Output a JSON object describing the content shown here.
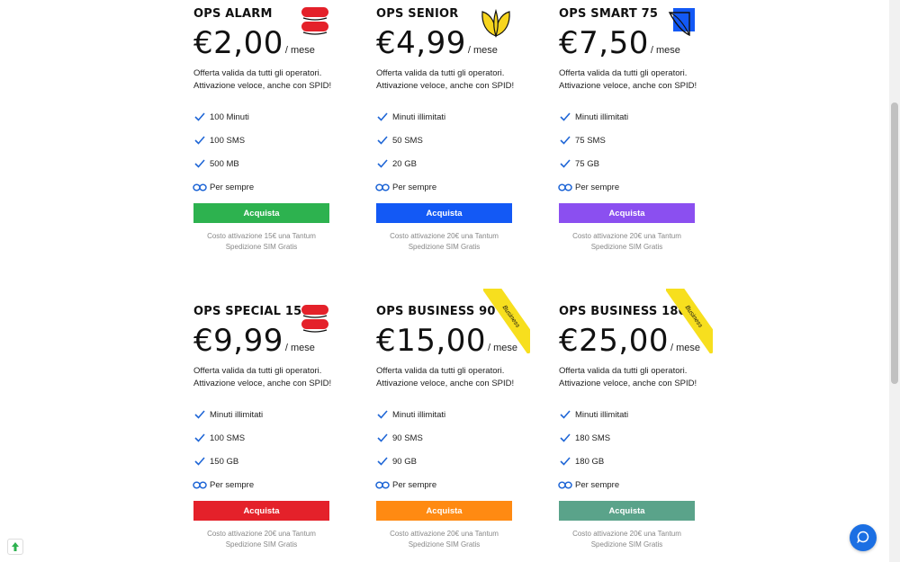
{
  "plans": [
    {
      "title": "OPS ALARM",
      "price": "€2,00",
      "per": "/ mese",
      "desc1": "Offerta valida da tutti gli operatori.",
      "desc2": "Attivazione veloce, anche con SPID!",
      "features": [
        "100 Minuti",
        "100 SMS",
        "500 MB",
        "Per sempre"
      ],
      "button": "Acquista",
      "button_color": "#2db24f",
      "note1": "Costo attivazione 15€ una Tantum",
      "note2": "Spedizione SIM Gratis",
      "logo": "red-stacked-pill-logo"
    },
    {
      "title": "OPS SENIOR",
      "price": "€4,99",
      "per": "/ mese",
      "desc1": "Offerta valida da tutti gli operatori.",
      "desc2": "Attivazione veloce, anche con SPID!",
      "features": [
        "Minuti illimitati",
        "50 SMS",
        "20 GB",
        "Per sempre"
      ],
      "button": "Acquista",
      "button_color": "#1359f5",
      "note1": "Costo attivazione 20€ una Tantum",
      "note2": "Spedizione SIM Gratis",
      "logo": "yellow-leaf-logo"
    },
    {
      "title": "OPS SMART 75",
      "price": "€7,50",
      "per": "/ mese",
      "desc1": "Offerta valida da tutti gli operatori.",
      "desc2": "Attivazione veloce, anche con SPID!",
      "features": [
        "Minuti illimitati",
        "75 SMS",
        "75 GB",
        "Per sempre"
      ],
      "button": "Acquista",
      "button_color": "#8b4ff0",
      "note1": "Costo attivazione 20€ una Tantum",
      "note2": "Spedizione SIM Gratis",
      "logo": "blue-page-logo"
    },
    {
      "title": "OPS SPECIAL 150",
      "price": "€9,99",
      "per": "/ mese",
      "desc1": "Offerta valida da tutti gli operatori.",
      "desc2": "Attivazione veloce, anche con SPID!",
      "features": [
        "Minuti illimitati",
        "100 SMS",
        "150 GB",
        "Per sempre"
      ],
      "button": "Acquista",
      "button_color": "#e4212a",
      "note1": "Costo attivazione 20€ una Tantum",
      "note2": "Spedizione SIM Gratis",
      "logo": "red-stacked-pill-logo"
    },
    {
      "title": "OPS BUSINESS 90",
      "price": "€15,00",
      "per": "/ mese",
      "desc1": "Offerta valida da tutti gli operatori.",
      "desc2": "Attivazione veloce, anche con SPID!",
      "features": [
        "Minuti illimitati",
        "90 SMS",
        "90 GB",
        "Per sempre"
      ],
      "button": "Acquista",
      "button_color": "#ff8a12",
      "note1": "Costo attivazione 20€ una Tantum",
      "note2": "Spedizione SIM Gratis",
      "ribbon": "Business"
    },
    {
      "title": "OPS BUSINESS 180",
      "price": "€25,00",
      "per": "/ mese",
      "desc1": "Offerta valida da tutti gli operatori.",
      "desc2": "Attivazione veloce, anche con SPID!",
      "features": [
        "Minuti illimitati",
        "180 SMS",
        "180 GB",
        "Per sempre"
      ],
      "button": "Acquista",
      "button_color": "#5aa38a",
      "note1": "Costo attivazione 20€ una Tantum",
      "note2": "Spedizione SIM Gratis",
      "ribbon": "Business"
    }
  ],
  "colors": {
    "check": "#1f66d6",
    "infinity": "#1f66d6",
    "logo_red": "#e4212a",
    "logo_yellow": "#f7d51e",
    "logo_blue": "#1359f5",
    "ribbon": "#f7df1e",
    "chat": "#1b6fe3"
  },
  "widgets": {
    "chat_icon": "chat-bubble-icon",
    "badge_icon": "green-upload-icon"
  }
}
